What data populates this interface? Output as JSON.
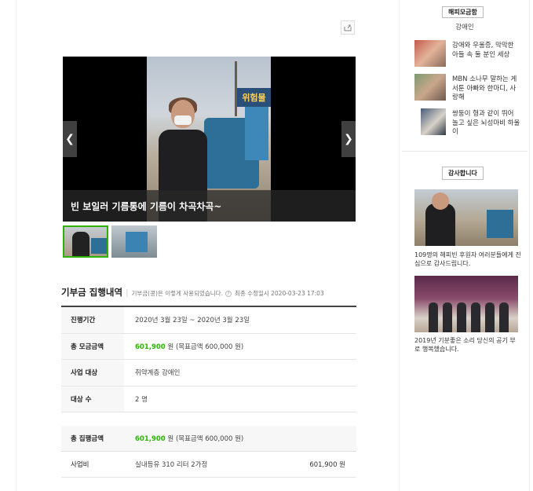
{
  "slider": {
    "caption": "빈 보일러 기름통에 기름이 차곡차곡~",
    "photo_sign": "위험물",
    "prev_icon": "chevron-left-icon",
    "next_icon": "chevron-right-icon"
  },
  "share": {
    "icon": "share-icon"
  },
  "execution": {
    "title": "기부금 집행내역",
    "description": "기부금(콩)은 이렇게 사용되었습니다.",
    "help_icon": "question-icon",
    "help_glyph": "?",
    "last_updated": "최종 수정일시 2020-03-23 17:03"
  },
  "info_table": [
    {
      "label": "진행기간",
      "value": "2020년 3월 23일 ~ 2020년 3월 23일"
    },
    {
      "label": "총 모금금액",
      "amount": "601,900",
      "rest": " 원 (목표금액 600,000 원)"
    },
    {
      "label": "사업 대상",
      "value": "취약계층 강애인"
    },
    {
      "label": "대상 수",
      "value": "2 명"
    }
  ],
  "spend_table": {
    "total": {
      "label": "총 집행금액",
      "amount": "601,900",
      "rest": " 원 (목표금액 600,000 원)"
    },
    "items": [
      {
        "label": "사업비",
        "detail": "실내등유 310 리터 2가정",
        "amount": "601,900 원"
      }
    ]
  },
  "sidebar": {
    "badge": "해피모금함",
    "subtitle": "강애인",
    "items": [
      {
        "text": "강애와 우울증, 막막한 아들 속 둘 분인 세상"
      },
      {
        "text": "MBN 소나무 말하는 게 서툰 아빠와 한마디, 사랑해"
      },
      {
        "text": "쌍둥이 형과 같이 뛰어 놀고 싶은 뇌성마비 하울이"
      }
    ],
    "thanks_badge": "감사합니다",
    "thanks": [
      {
        "caption": "109명의 해피빈 후원자 여러분들에게 진심으로 감사드립니다."
      },
      {
        "caption": "2019년 기분좋은 소리 당신의 공기 부로 행복했습니다."
      }
    ]
  }
}
